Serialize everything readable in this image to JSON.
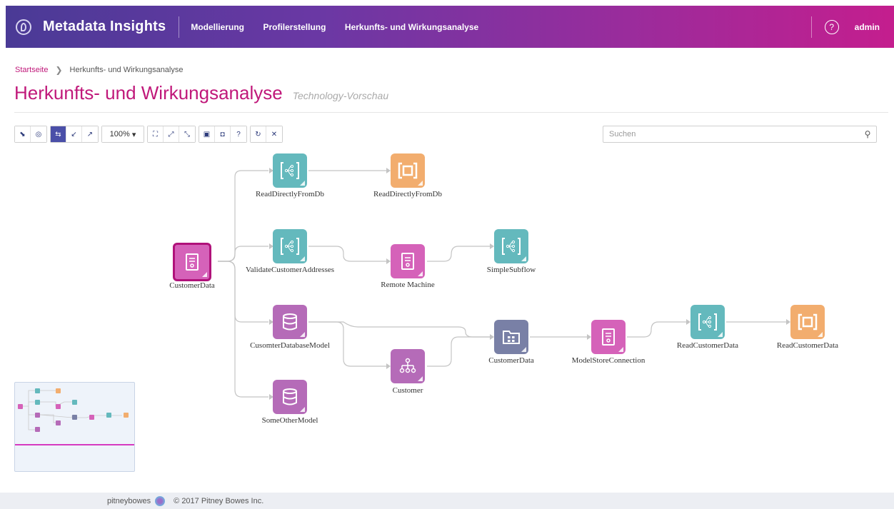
{
  "header": {
    "app_title": "Metadata Insights",
    "nav": [
      "Modellierung",
      "Profilerstellung",
      "Herkunfts- und Wirkungsanalyse"
    ],
    "help_icon": "help-circle-icon",
    "user": "admin"
  },
  "breadcrumb": {
    "home": "Startseite",
    "current": "Herkunfts- und Wirkungsanalyse"
  },
  "page": {
    "title": "Herkunfts- und Wirkungsanalyse",
    "subtitle": "Technology-Vorschau"
  },
  "toolbar": {
    "zoom": "100%",
    "help": "?"
  },
  "search": {
    "placeholder": "Suchen"
  },
  "nodes": [
    {
      "label": "CustomerData",
      "type": "file"
    },
    {
      "label": "ReadDirectlyFromDb",
      "type": "subflow"
    },
    {
      "label": "ReadDirectlyFromDb",
      "type": "stage"
    },
    {
      "label": "ValidateCustomerAddresses",
      "type": "subflow"
    },
    {
      "label": "Remote Machine",
      "type": "file"
    },
    {
      "label": "SimpleSubflow",
      "type": "subflow"
    },
    {
      "label": "CusomterDatabaseModel",
      "type": "database"
    },
    {
      "label": "Customer",
      "type": "hierarchy"
    },
    {
      "label": "CustomerData",
      "type": "folder"
    },
    {
      "label": "ModelStoreConnection",
      "type": "file"
    },
    {
      "label": "ReadCustomerData",
      "type": "subflow"
    },
    {
      "label": "ReadCustomerData",
      "type": "stage"
    },
    {
      "label": "SomeOtherModel",
      "type": "database"
    }
  ],
  "colors": {
    "teal": "#64b9bd",
    "orange": "#f2ad6e",
    "pink": "#d562b9",
    "purple": "#b56bb8",
    "slate": "#7980a6",
    "accent": "#c0187a"
  },
  "footer": {
    "brand": "pitneybowes",
    "copyright": "© 2017 Pitney Bowes Inc."
  }
}
